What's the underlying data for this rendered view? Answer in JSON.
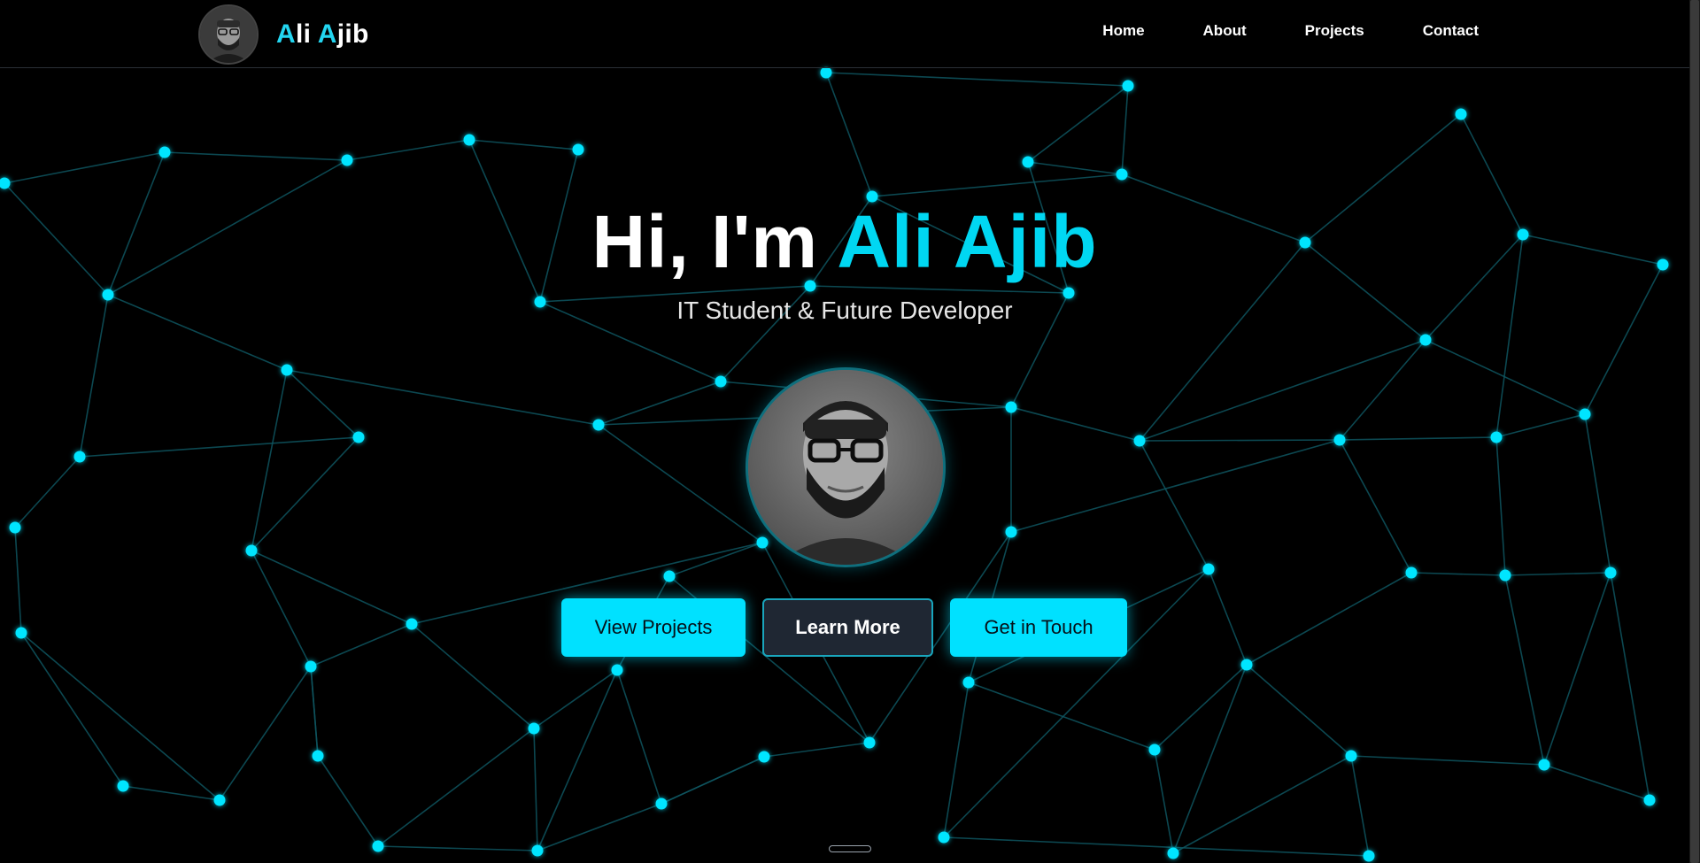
{
  "colors": {
    "background": "#000000",
    "accent": "#00e1ff",
    "network_node": "#00e5ff",
    "network_edge": "#0f5560",
    "secondary_button_bg": "#1f2733"
  },
  "navbar": {
    "brand": {
      "first_initial": "A",
      "first_rest": "li",
      "last_initial": "A",
      "last_rest": "jib",
      "avatar_icon": "profile-photo"
    },
    "links": [
      {
        "label": "Home"
      },
      {
        "label": "About"
      },
      {
        "label": "Projects"
      },
      {
        "label": "Contact"
      }
    ]
  },
  "hero": {
    "greeting": "Hi, I'm ",
    "name": "Ali Ajib",
    "subtitle": "IT Student & Future Developer",
    "portrait_icon": "profile-photo"
  },
  "cta": {
    "view_projects": "View Projects",
    "learn_more": "Learn More",
    "get_in_touch": "Get in Touch"
  },
  "scroll_indicator_icon": "scroll-pill-icon"
}
